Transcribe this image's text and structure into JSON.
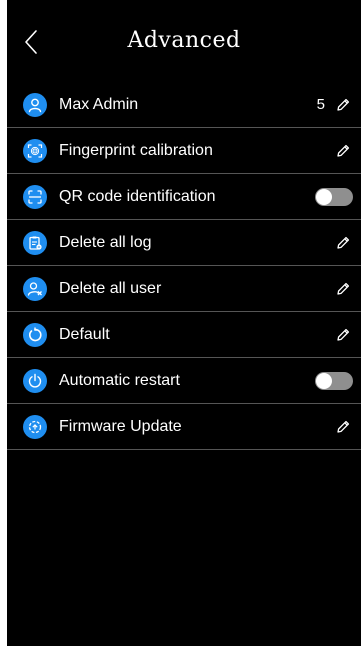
{
  "header": {
    "title": "Advanced",
    "back_icon": "chevron-left-icon"
  },
  "colors": {
    "background": "#000000",
    "accent": "#1f8ef0",
    "divider": "#555555",
    "toggle_off": "#8f8f8f"
  },
  "items": [
    {
      "label": "Max Admin",
      "icon": "user-icon",
      "value": "5",
      "control": "edit"
    },
    {
      "label": "Fingerprint calibration",
      "icon": "fingerprint-icon",
      "control": "edit"
    },
    {
      "label": "QR code identification",
      "icon": "qr-scan-icon",
      "control": "toggle",
      "toggle_on": false
    },
    {
      "label": "Delete all log",
      "icon": "clipboard-icon",
      "control": "edit"
    },
    {
      "label": "Delete all user",
      "icon": "user-remove-icon",
      "control": "edit"
    },
    {
      "label": "Default",
      "icon": "reset-icon",
      "control": "edit"
    },
    {
      "label": "Automatic restart",
      "icon": "power-icon",
      "control": "toggle",
      "toggle_on": false
    },
    {
      "label": "Firmware Update",
      "icon": "firmware-update-icon",
      "control": "edit"
    }
  ]
}
